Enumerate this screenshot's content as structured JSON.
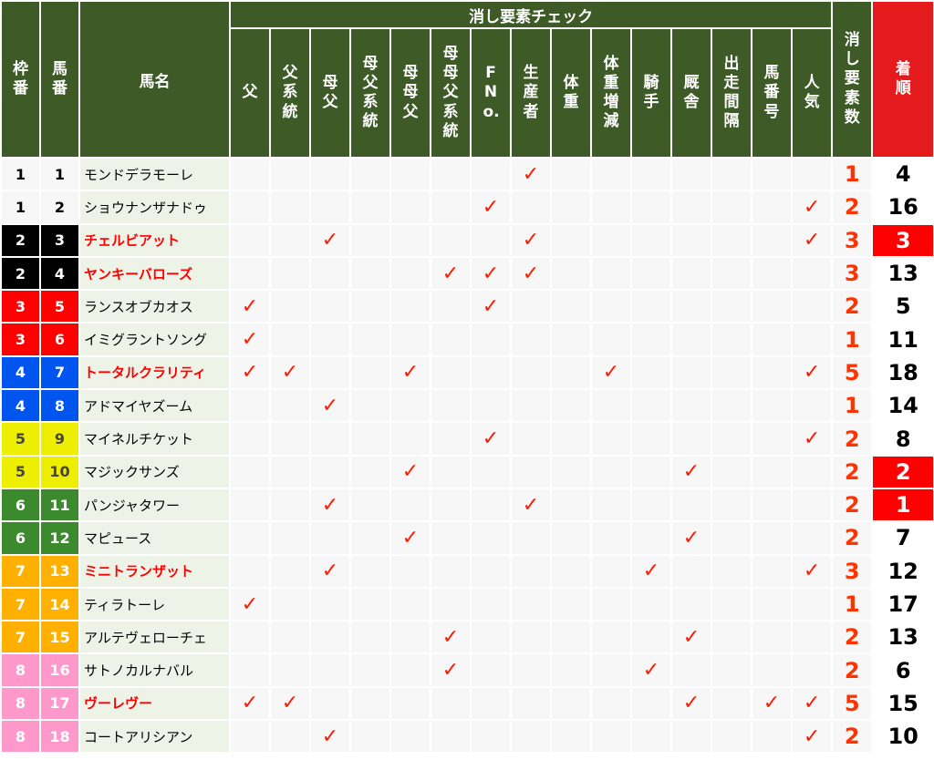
{
  "header": {
    "waku": "枠番",
    "umaban": "馬番",
    "name": "馬名",
    "group": "消し要素チェック",
    "columns": [
      "父",
      "父系統",
      "母父",
      "母父系統",
      "母母父",
      "母母父系統",
      "FNo.",
      "生産者",
      "体重",
      "体重増減",
      "騎手",
      "厩舎",
      "出走間隔",
      "馬番号",
      "人気"
    ],
    "count": "消し要素数",
    "result": "着順"
  },
  "check_mark": "✓",
  "rows": [
    {
      "waku": "1",
      "uma": "1",
      "name": "モンドデラモーレ",
      "red": false,
      "checks": [
        7
      ],
      "count": "1",
      "result": "4",
      "hl": false
    },
    {
      "waku": "1",
      "uma": "2",
      "name": "ショウナンザナドゥ",
      "red": false,
      "checks": [
        6,
        14
      ],
      "count": "2",
      "result": "16",
      "hl": false
    },
    {
      "waku": "2",
      "uma": "3",
      "name": "チェルビアット",
      "red": true,
      "checks": [
        2,
        7,
        14
      ],
      "count": "3",
      "result": "3",
      "hl": true
    },
    {
      "waku": "2",
      "uma": "4",
      "name": "ヤンキーバローズ",
      "red": true,
      "checks": [
        5,
        6,
        7
      ],
      "count": "3",
      "result": "13",
      "hl": false
    },
    {
      "waku": "3",
      "uma": "5",
      "name": "ランスオブカオス",
      "red": false,
      "checks": [
        0,
        6
      ],
      "count": "2",
      "result": "5",
      "hl": false
    },
    {
      "waku": "3",
      "uma": "6",
      "name": "イミグラントソング",
      "red": false,
      "checks": [
        0
      ],
      "count": "1",
      "result": "11",
      "hl": false
    },
    {
      "waku": "4",
      "uma": "7",
      "name": "トータルクラリティ",
      "red": true,
      "checks": [
        0,
        1,
        4,
        9,
        14
      ],
      "count": "5",
      "result": "18",
      "hl": false
    },
    {
      "waku": "4",
      "uma": "8",
      "name": "アドマイヤズーム",
      "red": false,
      "checks": [
        2
      ],
      "count": "1",
      "result": "14",
      "hl": false
    },
    {
      "waku": "5",
      "uma": "9",
      "name": "マイネルチケット",
      "red": false,
      "checks": [
        6,
        14
      ],
      "count": "2",
      "result": "8",
      "hl": false
    },
    {
      "waku": "5",
      "uma": "10",
      "name": "マジックサンズ",
      "red": false,
      "checks": [
        4,
        11
      ],
      "count": "2",
      "result": "2",
      "hl": true
    },
    {
      "waku": "6",
      "uma": "11",
      "name": "パンジャタワー",
      "red": false,
      "checks": [
        2,
        7
      ],
      "count": "2",
      "result": "1",
      "hl": true
    },
    {
      "waku": "6",
      "uma": "12",
      "name": "マピュース",
      "red": false,
      "checks": [
        4,
        11
      ],
      "count": "2",
      "result": "7",
      "hl": false
    },
    {
      "waku": "7",
      "uma": "13",
      "name": "ミニトランザット",
      "red": true,
      "checks": [
        2,
        10,
        14
      ],
      "count": "3",
      "result": "12",
      "hl": false
    },
    {
      "waku": "7",
      "uma": "14",
      "name": "ティラトーレ",
      "red": false,
      "checks": [
        0
      ],
      "count": "1",
      "result": "17",
      "hl": false
    },
    {
      "waku": "7",
      "uma": "15",
      "name": "アルテヴェローチェ",
      "red": false,
      "checks": [
        5,
        11
      ],
      "count": "2",
      "result": "13",
      "hl": false
    },
    {
      "waku": "8",
      "uma": "16",
      "name": "サトノカルナバル",
      "red": false,
      "checks": [
        5,
        10
      ],
      "count": "2",
      "result": "6",
      "hl": false
    },
    {
      "waku": "8",
      "uma": "17",
      "name": "ヴーレヴー",
      "red": true,
      "checks": [
        0,
        1,
        11,
        13,
        14
      ],
      "count": "5",
      "result": "15",
      "hl": false
    },
    {
      "waku": "8",
      "uma": "18",
      "name": "コートアリシアン",
      "red": false,
      "checks": [
        2,
        14
      ],
      "count": "2",
      "result": "10",
      "hl": false
    }
  ]
}
